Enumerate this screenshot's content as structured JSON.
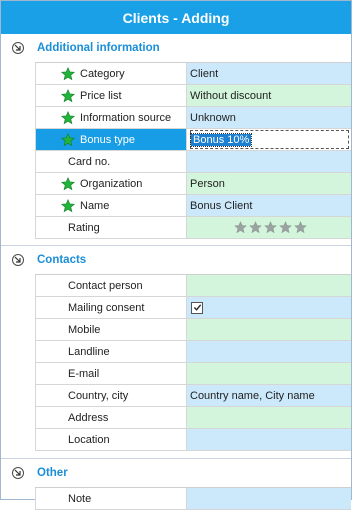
{
  "window": {
    "title": "Clients - Adding"
  },
  "sections": {
    "additional": {
      "title": "Additional information",
      "rows": [
        {
          "label": "Category",
          "value": "Client"
        },
        {
          "label": "Price list",
          "value": "Without discount"
        },
        {
          "label": "Information source",
          "value": "Unknown"
        },
        {
          "label": "Bonus type",
          "value": "Bonus 10%"
        },
        {
          "label": "Card no.",
          "value": ""
        },
        {
          "label": "Organization",
          "value": "Person"
        },
        {
          "label": "Name",
          "value": "Bonus Client"
        },
        {
          "label": "Rating",
          "value": ""
        }
      ],
      "rating_stars": 5
    },
    "contacts": {
      "title": "Contacts",
      "rows": [
        {
          "label": "Contact person",
          "value": ""
        },
        {
          "label": "Mailing consent",
          "value": ""
        },
        {
          "label": "Mobile",
          "value": ""
        },
        {
          "label": "Landline",
          "value": ""
        },
        {
          "label": "E-mail",
          "value": ""
        },
        {
          "label": "Country, city",
          "value": "Country name, City name"
        },
        {
          "label": "Address",
          "value": ""
        },
        {
          "label": "Location",
          "value": ""
        }
      ],
      "mailing_consent_checked": true
    },
    "other": {
      "title": "Other",
      "rows": [
        {
          "label": "Note",
          "value": ""
        }
      ]
    }
  },
  "colors": {
    "title_bar": "#1aa0e6",
    "section_title": "#1a8fd8",
    "value_blue": "#cce9fb",
    "value_green": "#d2f5dc",
    "selected": "#169de6",
    "required_star": "#22b33a",
    "rating_star": "#9aa3a0"
  }
}
